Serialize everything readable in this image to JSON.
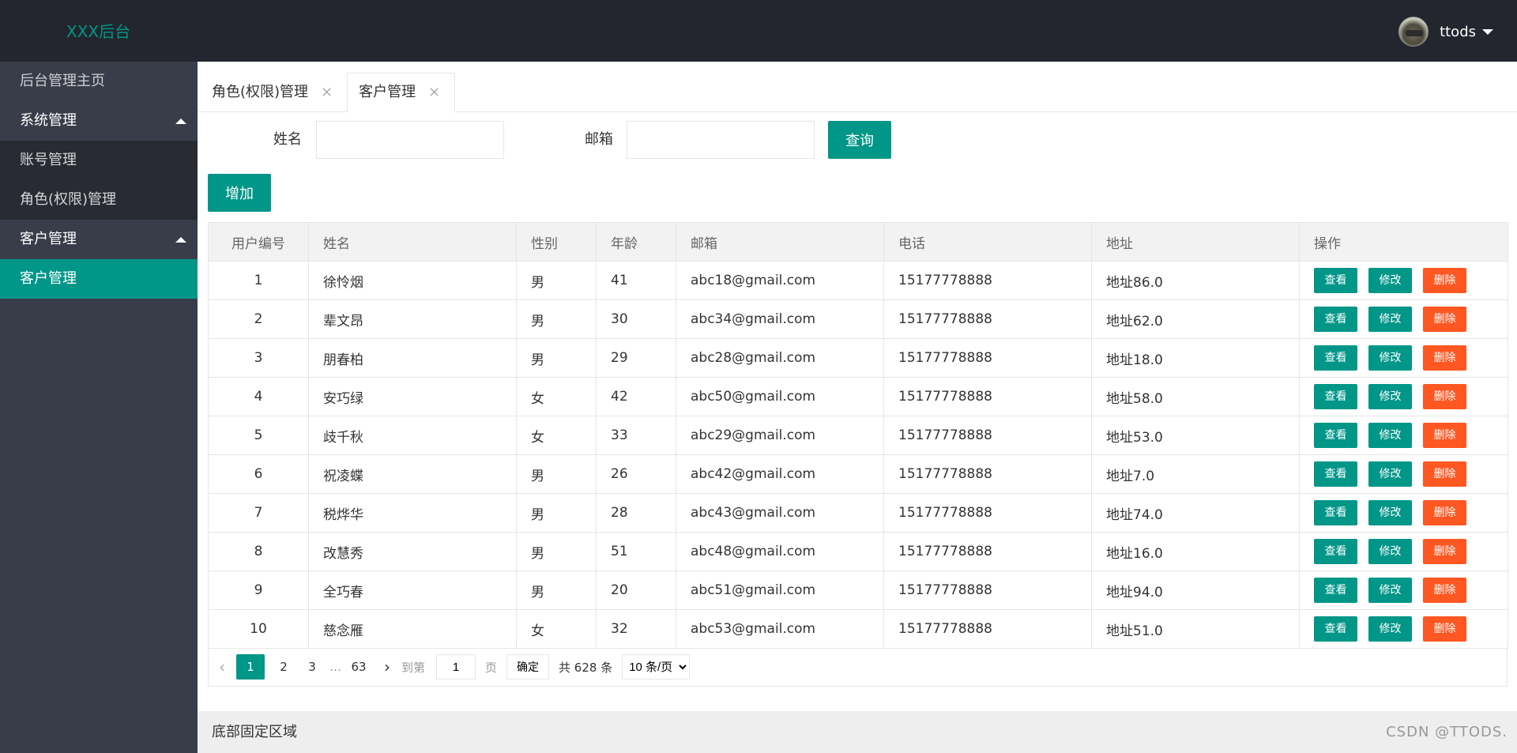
{
  "header": {
    "logo": "XXX后台",
    "username": "ttods"
  },
  "sidebar": {
    "home": "后台管理主页",
    "groups": [
      {
        "label": "系统管理",
        "children": [
          "账号管理",
          "角色(权限)管理"
        ]
      },
      {
        "label": "客户管理",
        "children": [
          "客户管理"
        ]
      }
    ]
  },
  "tabs": [
    {
      "label": "角色(权限)管理",
      "close": "×"
    },
    {
      "label": "客户管理",
      "close": "×"
    }
  ],
  "search": {
    "name_label": "姓名",
    "name_value": "",
    "email_label": "邮箱",
    "email_value": "",
    "query_button": "查询"
  },
  "add_button": "增加",
  "table": {
    "columns": [
      "用户编号",
      "姓名",
      "性别",
      "年龄",
      "邮箱",
      "电话",
      "地址",
      "操作"
    ],
    "actions": {
      "view": "查看",
      "edit": "修改",
      "delete": "删除"
    },
    "rows": [
      [
        "1",
        "徐怜烟",
        "男",
        "41",
        "abc18@gmail.com",
        "15177778888",
        "地址86.0"
      ],
      [
        "2",
        "辈文昂",
        "男",
        "30",
        "abc34@gmail.com",
        "15177778888",
        "地址62.0"
      ],
      [
        "3",
        "朋春柏",
        "男",
        "29",
        "abc28@gmail.com",
        "15177778888",
        "地址18.0"
      ],
      [
        "4",
        "安巧绿",
        "女",
        "42",
        "abc50@gmail.com",
        "15177778888",
        "地址58.0"
      ],
      [
        "5",
        "歧千秋",
        "女",
        "33",
        "abc29@gmail.com",
        "15177778888",
        "地址53.0"
      ],
      [
        "6",
        "祝凌蝶",
        "男",
        "26",
        "abc42@gmail.com",
        "15177778888",
        "地址7.0"
      ],
      [
        "7",
        "税烨华",
        "男",
        "28",
        "abc43@gmail.com",
        "15177778888",
        "地址74.0"
      ],
      [
        "8",
        "改慧秀",
        "男",
        "51",
        "abc48@gmail.com",
        "15177778888",
        "地址16.0"
      ],
      [
        "9",
        "全巧春",
        "男",
        "20",
        "abc51@gmail.com",
        "15177778888",
        "地址94.0"
      ],
      [
        "10",
        "慈念雁",
        "女",
        "32",
        "abc53@gmail.com",
        "15177778888",
        "地址51.0"
      ]
    ]
  },
  "pager": {
    "prev": "‹",
    "next": "›",
    "pages": [
      "1",
      "2",
      "3"
    ],
    "ellipsis": "…",
    "last": "63",
    "goto_label": "到第",
    "goto_value": "1",
    "page_unit": "页",
    "confirm": "确定",
    "total": "共 628 条",
    "page_size_options": [
      "10 条/页"
    ]
  },
  "footer": {
    "text": "底部固定区域",
    "watermark": "CSDN @TTODS."
  },
  "colors": {
    "primary": "#009688",
    "danger": "#ff5722",
    "header_bg": "#23262e",
    "sidebar_bg": "#393d49"
  }
}
